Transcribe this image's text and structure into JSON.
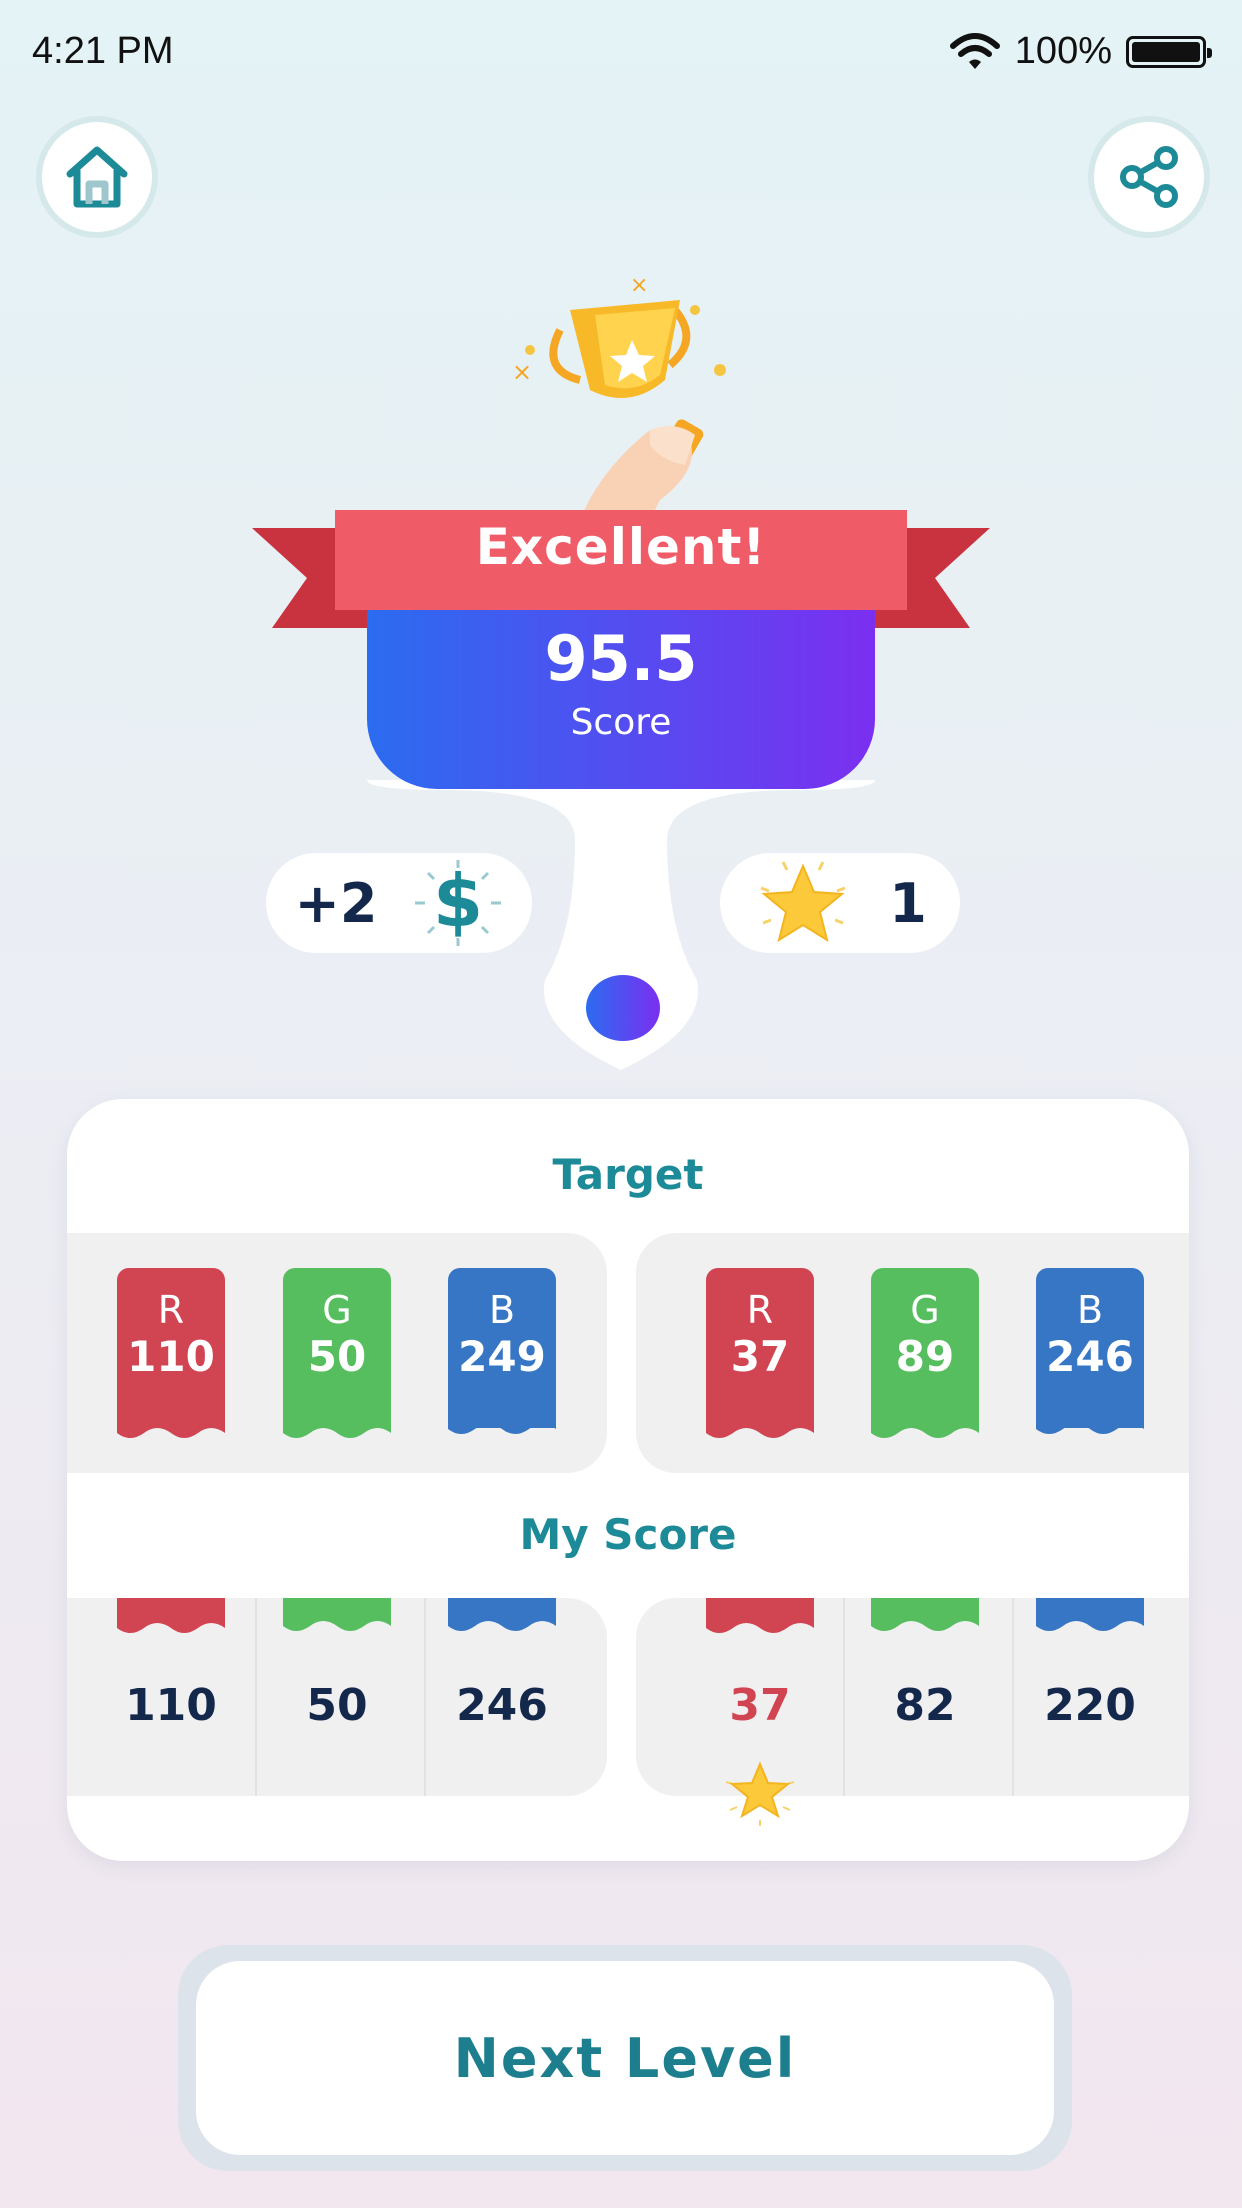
{
  "status_bar": {
    "time": "4:21 PM",
    "battery": "100%"
  },
  "header": {
    "home_icon": "home-icon",
    "share_icon": "share-icon"
  },
  "result": {
    "banner": "Excellent!",
    "score_value": "95.5",
    "score_label": "Score",
    "coins_reward": "+2",
    "stars_reward": "1"
  },
  "target": {
    "title": "Target",
    "sets": [
      {
        "r": "110",
        "g": "50",
        "b": "249"
      },
      {
        "r": "37",
        "g": "89",
        "b": "246"
      }
    ],
    "channel_labels": {
      "r": "R",
      "g": "G",
      "b": "B"
    }
  },
  "my_score": {
    "title": "My Score",
    "sets": [
      {
        "r": "110",
        "g": "50",
        "b": "246"
      },
      {
        "r": "37",
        "g": "82",
        "b": "220"
      }
    ]
  },
  "next_button": "Next Level",
  "colors": {
    "red": "#d14452",
    "green": "#56be5e",
    "blue": "#3676c4",
    "teal": "#1d8a98",
    "navy": "#14284b",
    "banner": "#ef5b66"
  }
}
